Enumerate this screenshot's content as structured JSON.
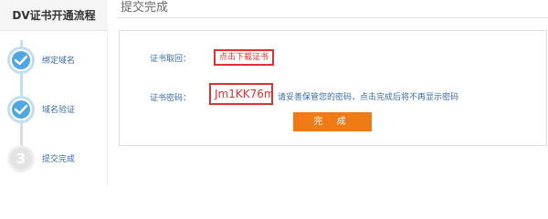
{
  "sidebar": {
    "title": "DV证书开通流程",
    "steps": [
      {
        "label": "绑定域名",
        "status": "done",
        "icon": "checkmark-icon"
      },
      {
        "label": "域名验证",
        "status": "done",
        "icon": "checkmark-icon"
      },
      {
        "label": "提交完成",
        "status": "current",
        "number": "3"
      }
    ]
  },
  "main": {
    "title": "提交完成",
    "fetch_label": "证书取回：",
    "download_link": "点击下载证书",
    "password_label": "证书密码：",
    "password_value": "Jm1KK76m",
    "password_hint": "请妥善保管您的密码，点击完成后将不再显示密码",
    "finish_button": "完 成"
  },
  "colors": {
    "accent_blue": "#4fa6e2",
    "alert_red": "#e03030",
    "button_orange": "#f07b16",
    "label_blue": "#3a6aa8"
  }
}
